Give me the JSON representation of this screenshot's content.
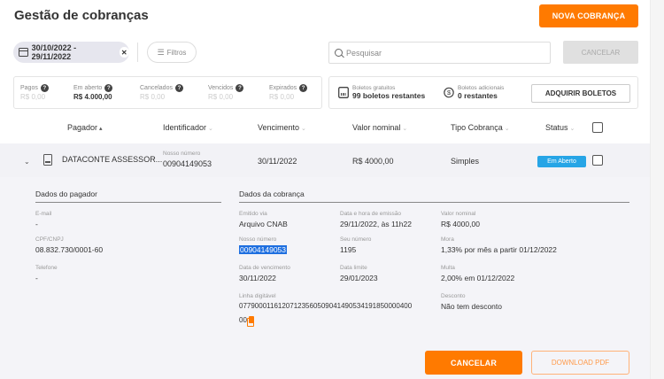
{
  "header": {
    "title": "Gestão de cobranças",
    "new_button": "NOVA COBRANÇA"
  },
  "filters": {
    "date_range": "30/10/2022 - 29/11/2022",
    "filters_label": "Filtros",
    "search_placeholder": "Pesquisar",
    "cancel_label": "CANCELAR"
  },
  "summary": [
    {
      "label": "Pagos",
      "value": "R$ 0,00",
      "active": false
    },
    {
      "label": "Em aberto",
      "value": "R$ 4.000,00",
      "active": true
    },
    {
      "label": "Cancelados",
      "value": "R$ 0,00",
      "active": false
    },
    {
      "label": "Vencidos",
      "value": "R$ 0,00",
      "active": false
    },
    {
      "label": "Expirados",
      "value": "R$ 0,00",
      "active": false
    }
  ],
  "boletos": {
    "free_label": "Boletos gratuitos",
    "free_value": "99 boletos restantes",
    "extra_label": "Boletos adicionais",
    "extra_value": "0 restantes",
    "buy_button": "ADQUIRIR BOLETOS"
  },
  "table": {
    "columns": [
      "Pagador",
      "Identificador",
      "Vencimento",
      "Valor nominal",
      "Tipo Cobrança",
      "Status"
    ],
    "row": {
      "payer": "DATACONTE ASSESSOR...",
      "id_label": "Nosso número",
      "id_value": "00904149053",
      "due": "30/11/2022",
      "amount": "R$ 4000,00",
      "type": "Simples",
      "status": "Em Aberto"
    }
  },
  "details": {
    "payer_title": "Dados do pagador",
    "email_label": "E-mail",
    "email_value": "-",
    "cpf_label": "CPF/CNPJ",
    "cpf_value": "08.832.730/0001-60",
    "phone_label": "Telefone",
    "phone_value": "-",
    "charge_title": "Dados da cobrança",
    "emitted_label": "Emitido via",
    "emitted_value": "Arquivo CNAB",
    "emission_date_label": "Data e hora de emissão",
    "emission_date_value": "29/11/2022, às 11h22",
    "nominal_label": "Valor nominal",
    "nominal_value": "R$ 4000,00",
    "nosso_label": "Nosso número",
    "nosso_value": "00904149053",
    "seu_label": "Seu número",
    "seu_value": "1195",
    "mora_label": "Mora",
    "mora_value": "1,33% por mês a partir 01/12/2022",
    "venc_label": "Data de vencimento",
    "venc_value": "30/11/2022",
    "limite_label": "Data limite",
    "limite_value": "29/01/2023",
    "multa_label": "Multa",
    "multa_value": "2,00% em 01/12/2022",
    "linha_label": "Linha digitável",
    "linha_value_1": "07790001161207123560509041490534191850000400",
    "linha_value_2": "00",
    "desconto_label": "Desconto",
    "desconto_value": "Não tem desconto",
    "cancel_button": "CANCELAR",
    "pdf_button": "DOWNLOAD PDF"
  },
  "colors": {
    "accent": "#ff7a00",
    "badge": "#27a5e6",
    "highlight": "#1e6fe0"
  }
}
